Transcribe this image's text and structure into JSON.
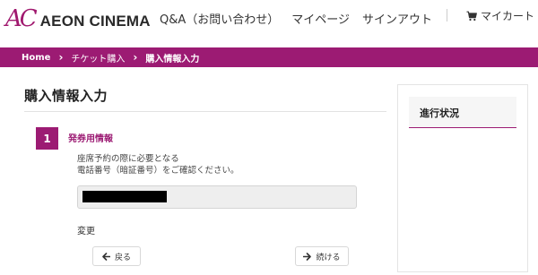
{
  "header": {
    "logo_mark": "AC",
    "logo_text": "AEON CINEMA",
    "nav": [
      "Q&A（お問い合わせ）",
      "マイページ",
      "サインアウト"
    ],
    "cart_label": "マイカート",
    "cart_icon": "cart-icon"
  },
  "breadcrumb": {
    "items": [
      "Home",
      "チケット購入",
      "購入情報入力"
    ],
    "separator_icon": "chevron-right-icon"
  },
  "main": {
    "page_title": "購入情報入力",
    "step": {
      "number": "1",
      "title": "発券用情報",
      "description_line1": "座席予約の際に必要となる",
      "description_line2": "電話番号（暗証番号）をご確認ください。",
      "change_link": "変更"
    },
    "buttons": {
      "back_label": "戻る",
      "back_icon": "arrow-left-icon",
      "next_label": "続ける",
      "next_icon": "arrow-right-icon"
    }
  },
  "sidebar": {
    "progress_title": "進行状況"
  },
  "colors": {
    "brand": "#9c1b73",
    "text": "#333333",
    "field_bg": "#eeeeee"
  }
}
